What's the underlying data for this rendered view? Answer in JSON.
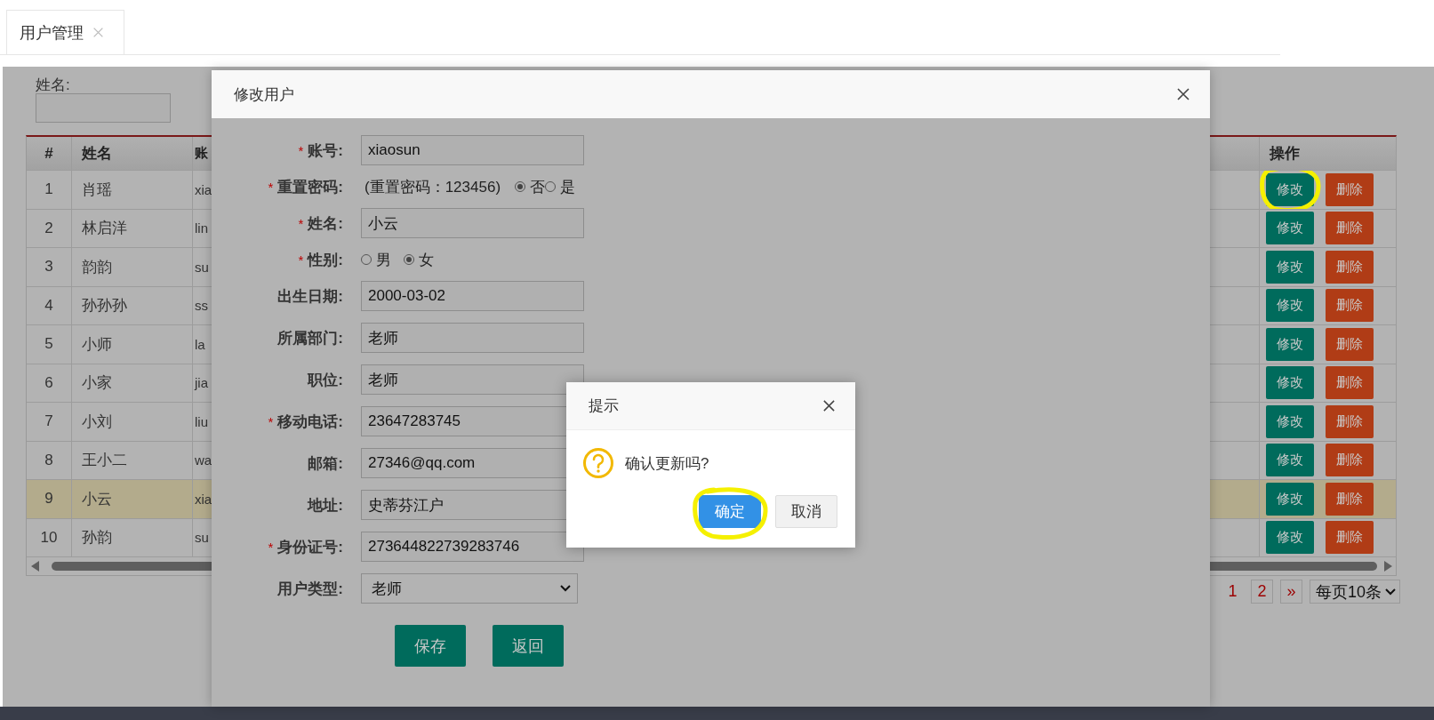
{
  "tabs": [
    {
      "label": "用户管理",
      "selected": true
    }
  ],
  "search": {
    "fields": [
      {
        "label": "姓名:"
      }
    ]
  },
  "table": {
    "columns": [
      "#",
      "姓名",
      "账",
      "操作"
    ],
    "rows": [
      {
        "index": "1",
        "name": "肖瑶",
        "account": "xia",
        "selected": false,
        "actions": [
          {
            "label": "修改",
            "kind": "edit",
            "highlighted": true
          },
          {
            "label": "删除",
            "kind": "delete",
            "highlighted": false
          }
        ]
      },
      {
        "index": "2",
        "name": "林启洋",
        "account": "lin",
        "selected": false,
        "actions": [
          {
            "label": "修改",
            "kind": "edit",
            "highlighted": false
          },
          {
            "label": "删除",
            "kind": "delete",
            "highlighted": false
          }
        ]
      },
      {
        "index": "3",
        "name": "韵韵",
        "account": "su",
        "selected": false,
        "actions": [
          {
            "label": "修改",
            "kind": "edit",
            "highlighted": false
          },
          {
            "label": "删除",
            "kind": "delete",
            "highlighted": false
          }
        ]
      },
      {
        "index": "4",
        "name": "孙孙孙",
        "account": "ss",
        "selected": false,
        "actions": [
          {
            "label": "修改",
            "kind": "edit",
            "highlighted": false
          },
          {
            "label": "删除",
            "kind": "delete",
            "highlighted": false
          }
        ]
      },
      {
        "index": "5",
        "name": "小师",
        "account": "la",
        "selected": false,
        "actions": [
          {
            "label": "修改",
            "kind": "edit",
            "highlighted": false
          },
          {
            "label": "删除",
            "kind": "delete",
            "highlighted": false
          }
        ]
      },
      {
        "index": "6",
        "name": "小家",
        "account": "jia",
        "selected": false,
        "actions": [
          {
            "label": "修改",
            "kind": "edit",
            "highlighted": false
          },
          {
            "label": "删除",
            "kind": "delete",
            "highlighted": false
          }
        ]
      },
      {
        "index": "7",
        "name": "小刘",
        "account": "liu",
        "selected": false,
        "actions": [
          {
            "label": "修改",
            "kind": "edit",
            "highlighted": false
          },
          {
            "label": "删除",
            "kind": "delete",
            "highlighted": false
          }
        ]
      },
      {
        "index": "8",
        "name": "王小二",
        "account": "wa",
        "selected": false,
        "actions": [
          {
            "label": "修改",
            "kind": "edit",
            "highlighted": false
          },
          {
            "label": "删除",
            "kind": "delete",
            "highlighted": false
          }
        ]
      },
      {
        "index": "9",
        "name": "小云",
        "account": "xia",
        "selected": true,
        "actions": [
          {
            "label": "修改",
            "kind": "edit",
            "highlighted": false
          },
          {
            "label": "删除",
            "kind": "delete",
            "highlighted": false
          }
        ]
      },
      {
        "index": "10",
        "name": "孙韵",
        "account": "su",
        "selected": false,
        "actions": [
          {
            "label": "修改",
            "kind": "edit",
            "highlighted": false
          },
          {
            "label": "删除",
            "kind": "delete",
            "highlighted": false
          }
        ]
      }
    ]
  },
  "pagination": {
    "pages": [
      {
        "label": "1",
        "selected": true
      },
      {
        "label": "2",
        "selected": false
      }
    ],
    "next": "»",
    "page_size": "每页10条"
  },
  "modal": {
    "title": "修改用户",
    "fields": [
      {
        "label": "账号:",
        "marker": "*",
        "kind": "text",
        "value": "xiaosun"
      },
      {
        "label": "重置密码:",
        "marker": "*",
        "kind": "radio",
        "note": "(重置密码：123456)",
        "options": [
          {
            "label": "否",
            "selected": true
          },
          {
            "label": "是",
            "selected": false
          }
        ]
      },
      {
        "label": "姓名:",
        "marker": "*",
        "kind": "text",
        "value": "小云"
      },
      {
        "label": "性别:",
        "marker": "*",
        "kind": "radio",
        "options": [
          {
            "label": "男",
            "selected": false
          },
          {
            "label": "女",
            "selected": true
          }
        ]
      },
      {
        "label": "出生日期:",
        "kind": "text",
        "value": "2000-03-02"
      },
      {
        "label": "所属部门:",
        "kind": "text",
        "value": "老师"
      },
      {
        "label": "职位:",
        "kind": "text",
        "value": "老师"
      },
      {
        "label": "移动电话:",
        "marker": "*",
        "kind": "text",
        "value": "23647283745"
      },
      {
        "label": "邮箱:",
        "kind": "text",
        "value": "27346@qq.com"
      },
      {
        "label": "地址:",
        "kind": "text",
        "value": "史蒂芬江户"
      },
      {
        "label": "身份证号:",
        "marker": "*",
        "kind": "text",
        "value": "273644822739283746"
      },
      {
        "label": "用户类型:",
        "kind": "select",
        "value": "老师"
      }
    ],
    "buttons": [
      "保存",
      "返回"
    ]
  },
  "dialog": {
    "title": "提示",
    "message": "确认更新吗?",
    "buttons": [
      {
        "label": "确定",
        "kind": "primary",
        "highlighted": true
      },
      {
        "label": "取消",
        "kind": "default",
        "highlighted": false
      }
    ]
  }
}
